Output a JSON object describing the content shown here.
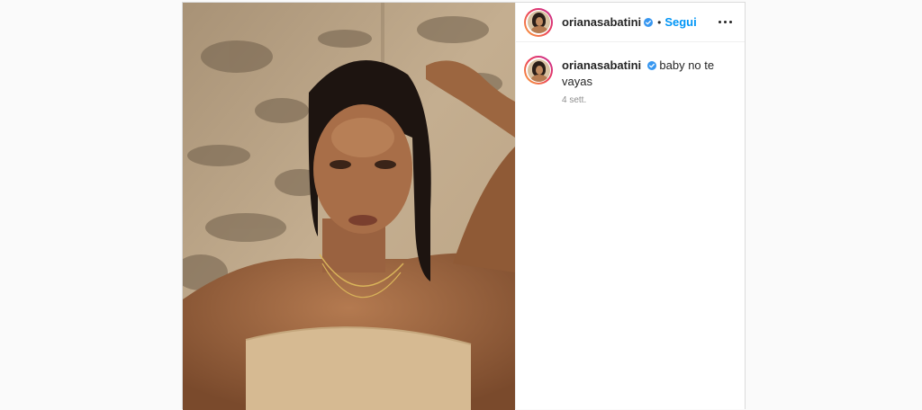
{
  "post": {
    "username": "orianasabatini",
    "dot": "•",
    "follow_label": "Segui",
    "more_icon": "more-horizontal-icon",
    "verified_icon": "verified-badge-icon",
    "caption": {
      "username": "orianasabatini",
      "text": "baby no te vayas",
      "timestamp": "4 sett."
    }
  },
  "colors": {
    "follow": "#0095f6",
    "verified": "#3897f0",
    "border": "#dbdbdb",
    "page_bg": "#fafafa"
  }
}
